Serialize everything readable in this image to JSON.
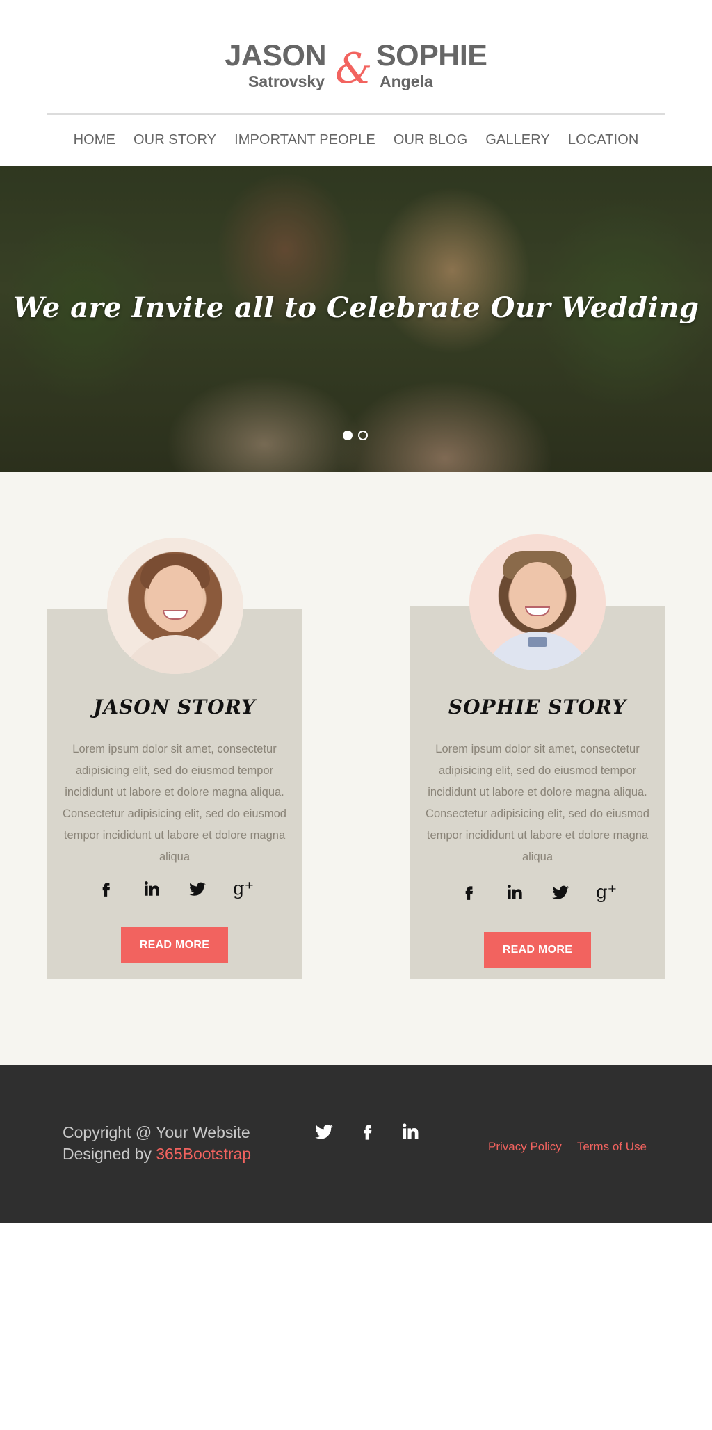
{
  "header": {
    "groom_first": "JASON",
    "groom_last": "Satrovsky",
    "ampersand": "&",
    "bride_first": "SOPHIE",
    "bride_last": "Angela",
    "accent_color": "#f2635f"
  },
  "nav": {
    "items": [
      {
        "label": "HOME"
      },
      {
        "label": "OUR STORY"
      },
      {
        "label": "IMPORTANT PEOPLE"
      },
      {
        "label": "OUR BLOG"
      },
      {
        "label": "GALLERY"
      },
      {
        "label": "LOCATION"
      }
    ]
  },
  "hero": {
    "tagline": "We are Invite all to Celebrate Our Wedding",
    "slides": 2,
    "active_slide": 1
  },
  "stories": [
    {
      "title": "JASON STORY",
      "text": "Lorem ipsum dolor sit amet, consectetur adipisicing elit, sed do eiusmod tempor incididunt ut labore et dolore magna aliqua. Consectetur adipisicing elit, sed do eiusmod tempor incididunt ut labore et dolore magna aliqua",
      "socials": [
        "facebook-icon",
        "linkedin-icon",
        "twitter-icon",
        "google-plus-icon"
      ],
      "button": "READ MORE"
    },
    {
      "title": "SOPHIE STORY",
      "text": "Lorem ipsum dolor sit amet, consectetur adipisicing elit, sed do eiusmod tempor incididunt ut labore et dolore magna aliqua. Consectetur adipisicing elit, sed do eiusmod tempor incididunt ut labore et dolore magna aliqua",
      "socials": [
        "facebook-icon",
        "linkedin-icon",
        "twitter-icon",
        "google-plus-icon"
      ],
      "button": "READ MORE"
    }
  ],
  "footer": {
    "copyright": "Copyright @ Your Website",
    "designed_by": "Designed by ",
    "brand": "365Bootstrap",
    "socials": [
      "twitter-icon",
      "facebook-icon",
      "linkedin-icon"
    ],
    "links": [
      "Privacy Policy",
      "Terms of Use"
    ]
  }
}
